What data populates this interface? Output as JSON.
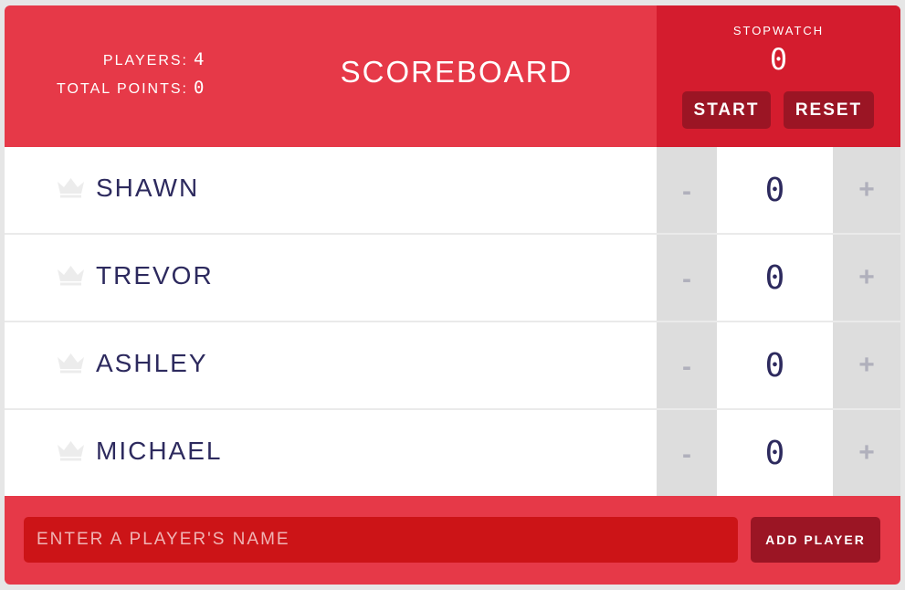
{
  "header": {
    "players_label": "PLAYERS:",
    "players_count": "4",
    "total_points_label": "TOTAL POINTS:",
    "total_points_value": "0",
    "title": "SCOREBOARD"
  },
  "stopwatch": {
    "title": "STOPWATCH",
    "time": "0",
    "start_label": "START",
    "reset_label": "RESET"
  },
  "players": [
    {
      "name": "SHAWN",
      "score": "0"
    },
    {
      "name": "TREVOR",
      "score": "0"
    },
    {
      "name": "ASHLEY",
      "score": "0"
    },
    {
      "name": "MICHAEL",
      "score": "0"
    }
  ],
  "counter": {
    "minus_label": "-",
    "plus_label": "+"
  },
  "form": {
    "placeholder": "ENTER A PLAYER'S NAME",
    "value": "",
    "add_label": "ADD PLAYER"
  },
  "colors": {
    "header_bg": "#e63948",
    "stopwatch_bg": "#d41c2e",
    "button_bg": "#9b1524",
    "input_bg": "#cc1417",
    "text_dark": "#2d2a5e",
    "counter_bg": "#dddddd",
    "crown": "#ececec"
  },
  "icons": {
    "crown": "crown-icon"
  }
}
